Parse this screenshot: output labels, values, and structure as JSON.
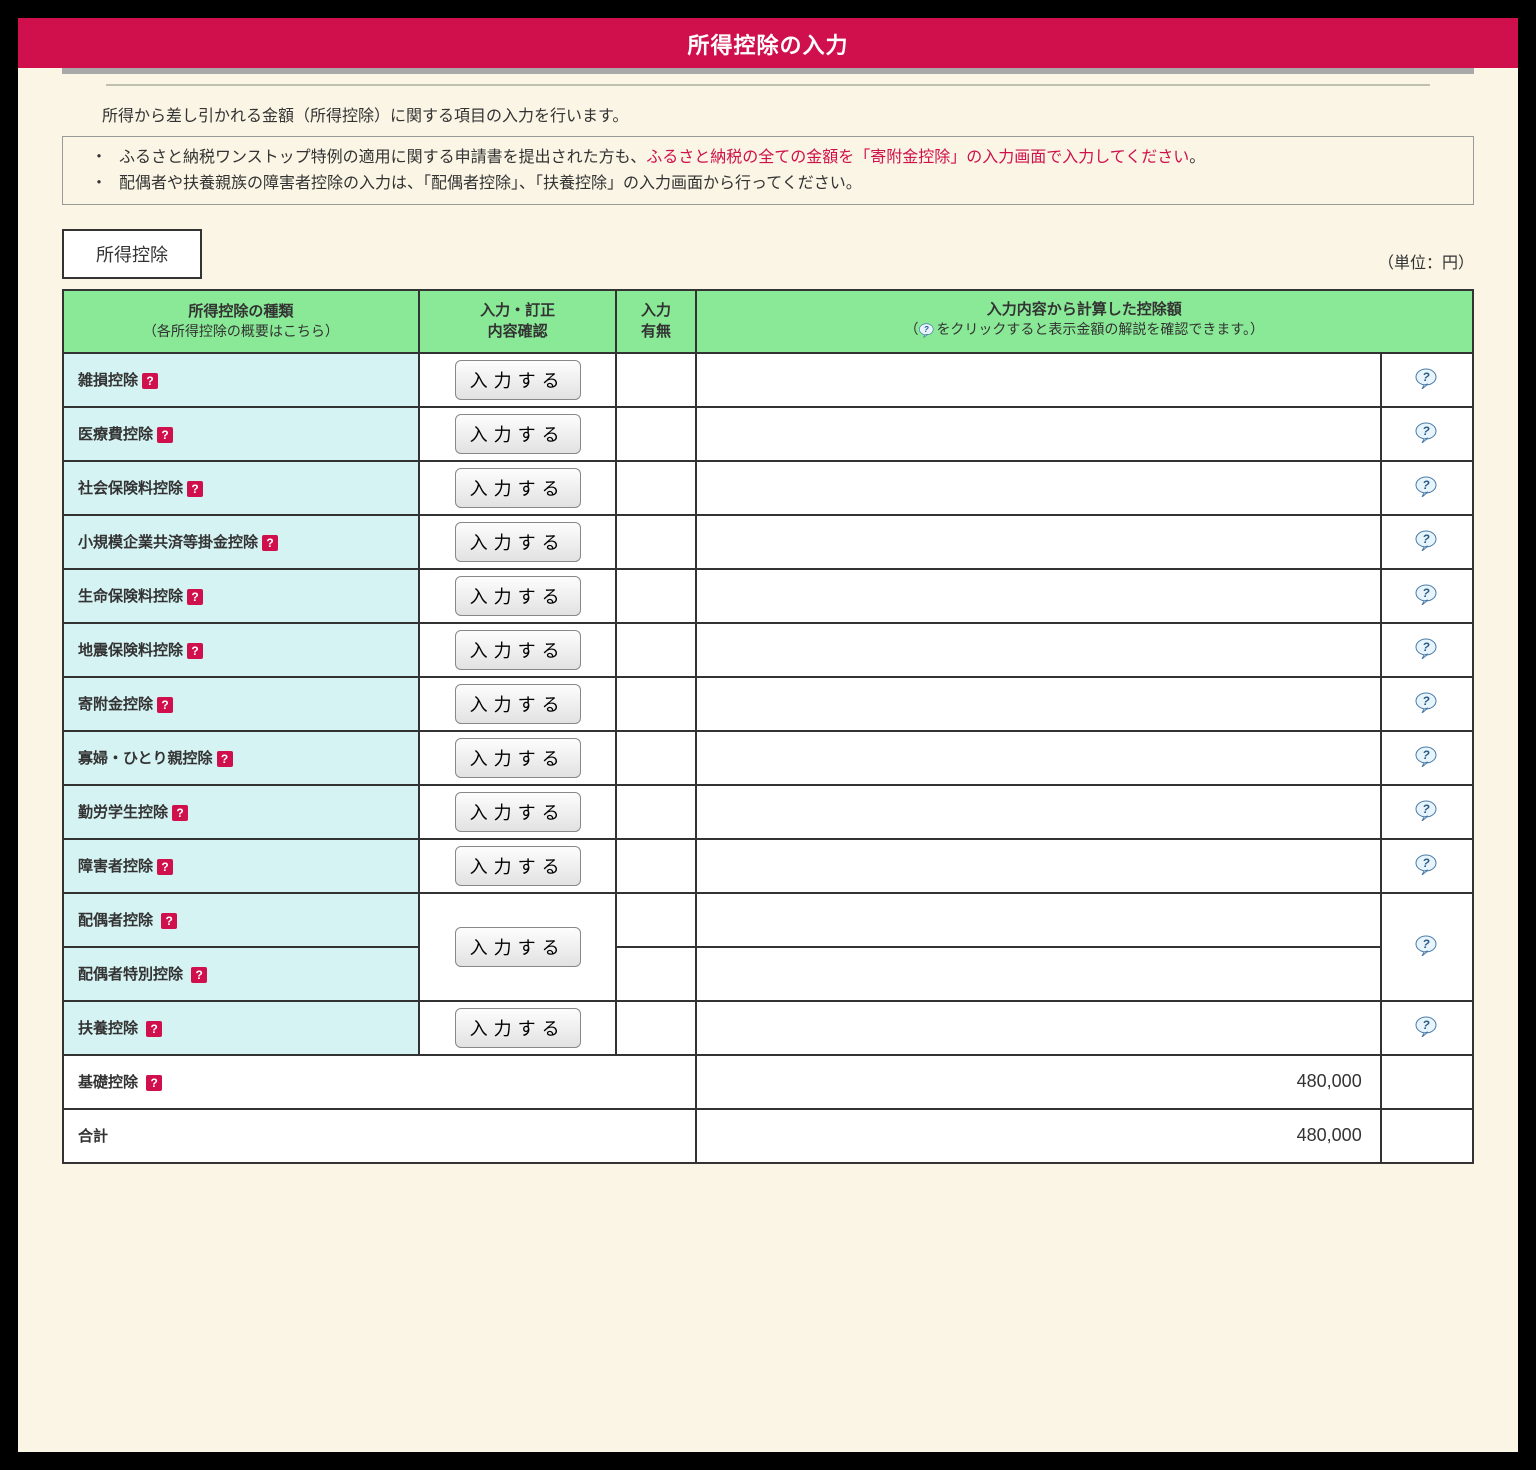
{
  "title": "所得控除の入力",
  "intro": "所得から差し引かれる金額（所得控除）に関する項目の入力を行います。",
  "notice": {
    "line1_a": "ふるさと納税ワンストップ特例の適用に関する申請書を提出された方も、",
    "line1_b": "ふるさと納税の全ての金額を「寄附金控除」の入力画面で入力してください",
    "line1_c": "。",
    "line2": "配偶者や扶養親族の障害者控除の入力は、「配偶者控除」、「扶養控除」の入力画面から行ってください。"
  },
  "tab_label": "所得控除",
  "unit_label": "（単位：円）",
  "headers": {
    "col_type": "所得控除の種類",
    "col_type_sub": "（各所得控除の概要はこちら）",
    "col_input": "入力・訂正\n内容確認",
    "col_status_1": "入力",
    "col_status_2": "有無",
    "col_amount": "入力内容から計算した控除額",
    "col_amount_sub_a": "（",
    "col_amount_sub_b": "をクリックすると表示金額の解説を確認できます。）"
  },
  "input_button_label": "入力する",
  "rows": [
    {
      "name": "雑損控除",
      "has_button": true,
      "amount": "",
      "has_help": true
    },
    {
      "name": "医療費控除",
      "has_button": true,
      "amount": "",
      "has_help": true
    },
    {
      "name": "社会保険料控除",
      "has_button": true,
      "amount": "",
      "has_help": true
    },
    {
      "name": "小規模企業共済等掛金控除",
      "has_button": true,
      "amount": "",
      "has_help": true
    },
    {
      "name": "生命保険料控除",
      "has_button": true,
      "amount": "",
      "has_help": true
    },
    {
      "name": "地震保険料控除",
      "has_button": true,
      "amount": "",
      "has_help": true
    },
    {
      "name": "寄附金控除",
      "has_button": true,
      "amount": "",
      "has_help": true
    },
    {
      "name": "寡婦・ひとり親控除",
      "has_button": true,
      "amount": "",
      "has_help": true
    },
    {
      "name": "勤労学生控除",
      "has_button": true,
      "amount": "",
      "has_help": true
    },
    {
      "name": "障害者控除",
      "has_button": true,
      "amount": "",
      "has_help": true
    }
  ],
  "spouse": {
    "name1": "配偶者控除",
    "name2": "配偶者特別控除",
    "amount1": "",
    "amount2": ""
  },
  "dependent": {
    "name": "扶養控除",
    "amount": ""
  },
  "basic": {
    "name": "基礎控除",
    "amount": "480,000"
  },
  "total": {
    "label": "合計",
    "amount": "480,000"
  }
}
